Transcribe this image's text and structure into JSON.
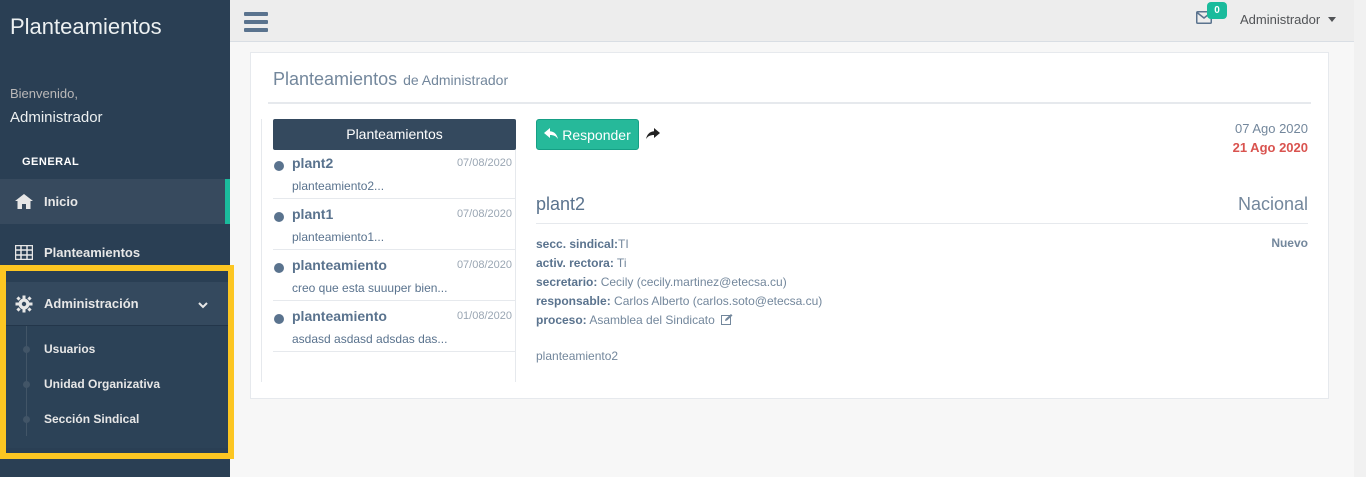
{
  "sidebar": {
    "app_title": "Planteamientos",
    "welcome": "Bienvenido,",
    "username": "Administrador",
    "section": "GENERAL",
    "items": [
      {
        "label": "Inicio",
        "icon": "home-icon"
      },
      {
        "label": "Planteamientos",
        "icon": "table-icon"
      },
      {
        "label": "Administración",
        "icon": "gear-icon"
      }
    ],
    "submenu": [
      "Usuarios",
      "Unidad Organizativa",
      "Sección Sindical"
    ]
  },
  "topnav": {
    "mail_count": "0",
    "user": "Administrador"
  },
  "panel": {
    "title": "Planteamientos",
    "subtitle": "de Administrador",
    "list_header": "Planteamientos",
    "messages": [
      {
        "subject": "plant2",
        "date": "07/08/2020",
        "snippet": "planteamiento2..."
      },
      {
        "subject": "plant1",
        "date": "07/08/2020",
        "snippet": "planteamiento1..."
      },
      {
        "subject": "planteamiento",
        "date": "07/08/2020",
        "snippet": "creo que esta suuuper bien..."
      },
      {
        "subject": "planteamiento",
        "date": "01/08/2020",
        "snippet": "asdasd asdasd adsdas das..."
      }
    ]
  },
  "detail": {
    "reply_label": "Responder",
    "date_sent": "07 Ago 2020",
    "date_due": "21 Ago 2020",
    "subject": "plant2",
    "scope": "Nacional",
    "status": "Nuevo",
    "fields": [
      {
        "label": "secc. sindical:",
        "value": "TI"
      },
      {
        "label": "activ. rectora:",
        "value": " Ti"
      },
      {
        "label": "secretario:",
        "value": " Cecily (cecily.martinez@etecsa.cu)"
      },
      {
        "label": "responsable:",
        "value": " Carlos Alberto (carlos.soto@etecsa.cu)"
      },
      {
        "label": "proceso:",
        "value": " Asamblea del Sindicato"
      }
    ],
    "body": "planteamiento2"
  },
  "colors": {
    "sidebar": "#2a3f54",
    "accent": "#1abb9c",
    "button": "#26b99a",
    "due_date": "#d9534f",
    "highlight": "#fcc622"
  }
}
